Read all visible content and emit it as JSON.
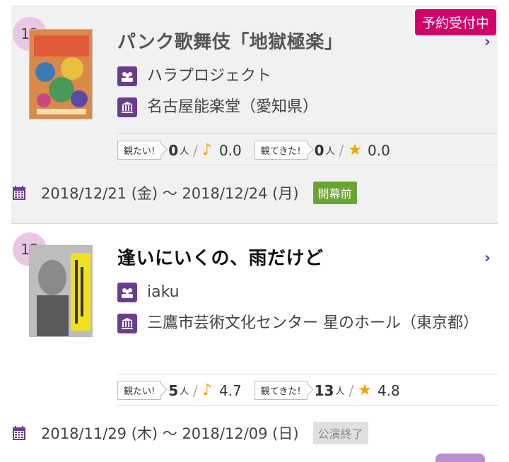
{
  "items": [
    {
      "rank": "12",
      "title": "パンク歌舞伎「地獄極楽」",
      "badge": "予約受付中",
      "group": "ハラプロジェクト",
      "venue": "名古屋能楽堂（愛知県）",
      "want_label": "観たい!",
      "want_count": "0",
      "want_unit": "人",
      "want_score": "0.0",
      "seen_label": "観てきた!",
      "seen_count": "0",
      "seen_unit": "人",
      "seen_score": "0.0",
      "dates": "2018/12/21 (金) 〜 2018/12/24 (月)",
      "status": "開幕前"
    },
    {
      "rank": "13",
      "title": "逢いにいくの、雨だけど",
      "group": "iaku",
      "venue": "三鷹市芸術文化センター 星のホール（東京都）",
      "want_label": "観たい!",
      "want_count": "5",
      "want_unit": "人",
      "want_score": "4.7",
      "seen_label": "観てきた!",
      "seen_count": "13",
      "seen_unit": "人",
      "seen_score": "4.8",
      "dates": "2018/11/29 (木) 〜 2018/12/09 (日)",
      "status": "公演終了"
    }
  ],
  "icons": {
    "group": "group-icon",
    "venue": "theater-icon",
    "date": "calendar-icon",
    "want": "music-note-icon",
    "seen": "star-icon",
    "more": "chevron-right-icon"
  },
  "colors": {
    "accent": "#6b3d8f",
    "reserve_badge": "#d4006a",
    "status_open": "#6aa532",
    "status_end": "#e0e0e0",
    "rank_circle": "#e8c6e4",
    "rating": "#f0a500"
  }
}
